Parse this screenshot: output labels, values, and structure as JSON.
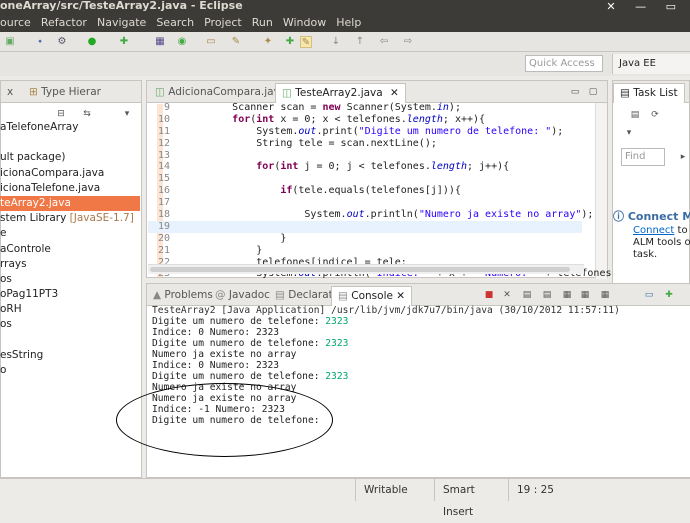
{
  "window": {
    "title": "oneArray/src/TesteArray2.java - Eclipse",
    "controls": "✕ — ▭"
  },
  "menu": [
    "ource",
    "Refactor",
    "Navigate",
    "Search",
    "Project",
    "Run",
    "Window",
    "Help"
  ],
  "quick_access": {
    "placeholder": "Quick Access"
  },
  "perspective": {
    "label": "Java EE"
  },
  "package_explorer": {
    "tabs": [
      {
        "label": "x"
      },
      {
        "label": "Type Hierar"
      }
    ],
    "items": [
      {
        "text": "aTelefoneArray",
        "sel": false,
        "orange": false
      },
      {
        "text": "",
        "sel": false,
        "orange": false
      },
      {
        "text": "ult package)",
        "sel": false,
        "orange": false
      },
      {
        "text": "icionaCompara.java",
        "sel": false,
        "orange": false
      },
      {
        "text": "icionaTelefone.java",
        "sel": false,
        "orange": false
      },
      {
        "text": "teArray2.java",
        "sel": true,
        "orange": false
      },
      {
        "text": "stem Library ",
        "extra": "[JavaSE-1.7]",
        "sel": false,
        "orange": false
      },
      {
        "text": "e",
        "sel": false,
        "orange": false
      },
      {
        "text": "aControle",
        "sel": false,
        "orange": false
      },
      {
        "text": "rrays",
        "sel": false,
        "orange": false
      },
      {
        "text": "os",
        "sel": false,
        "orange": false
      },
      {
        "text": "oPag11PT3",
        "sel": false,
        "orange": false
      },
      {
        "text": "oRH",
        "sel": false,
        "orange": false
      },
      {
        "text": "os",
        "sel": false,
        "orange": false
      },
      {
        "text": "",
        "sel": false,
        "orange": false
      },
      {
        "text": "esString",
        "sel": false,
        "orange": false
      },
      {
        "text": "o",
        "sel": false,
        "orange": false
      }
    ]
  },
  "editor": {
    "tabs": [
      {
        "label": "AdicionaCompara.java"
      },
      {
        "label": "TesteArray2.java"
      }
    ],
    "lines": [
      {
        "n": "9",
        "html": "        Scanner scan = <span class=\"kw\">new</span> Scanner(System.<span class=\"fld\">in</span>);"
      },
      {
        "n": "10",
        "html": "        <span class=\"kw\">for</span>(<span class=\"kw\">int</span> x = 0; x &lt; telefones.<span class=\"fld\">length</span>; x++){"
      },
      {
        "n": "11",
        "html": "            System.<span class=\"fld\">out</span>.print(<span class=\"str\">\"Digite um numero de telefone: \"</span>);"
      },
      {
        "n": "12",
        "html": "            String tele = scan.nextLine();"
      },
      {
        "n": "13",
        "html": ""
      },
      {
        "n": "14",
        "html": "            <span class=\"kw\">for</span>(<span class=\"kw\">int</span> j = 0; j &lt; telefones.<span class=\"fld\">length</span>; j++){"
      },
      {
        "n": "15",
        "html": ""
      },
      {
        "n": "16",
        "html": "                <span class=\"kw\">if</span>(tele.equals(telefones[j])){"
      },
      {
        "n": "17",
        "html": ""
      },
      {
        "n": "18",
        "html": "                    System.<span class=\"fld\">out</span>.println(<span class=\"str\">\"Numero ja existe no array\"</span>);"
      },
      {
        "n": "19",
        "html": ""
      },
      {
        "n": "20",
        "html": "                }"
      },
      {
        "n": "21",
        "html": "            }"
      },
      {
        "n": "22",
        "html": "            telefones[indice] = tele;"
      },
      {
        "n": "23",
        "html": "            System.<span class=\"fld\">out</span>.println(<span class=\"str\">\"Indice: \"</span> + x + <span class=\"str\">\" Numero: \"</span> + telefones[in"
      }
    ]
  },
  "task_list": {
    "tab_label": "Task List",
    "find_placeholder": "Find",
    "connect_title": "Connect M",
    "connect_link": "Connect",
    "connect_text1": " to y",
    "connect_text2": "ALM tools or",
    "connect_text3": "task."
  },
  "bottom_tabs": [
    {
      "label": "Problems"
    },
    {
      "label": "Javadoc"
    },
    {
      "label": "Declaration"
    },
    {
      "label": "Console"
    }
  ],
  "console": {
    "header": "TesteArray2 [Java Application] /usr/lib/jvm/jdk7u7/bin/java (30/10/2012 11:57:11)",
    "lines": [
      {
        "text": "Digite um numero de telefone: ",
        "input": "2323"
      },
      {
        "text": "Indice: 0 Numero: 2323",
        "input": ""
      },
      {
        "text": "Digite um numero de telefone: ",
        "input": "2323"
      },
      {
        "text": "Numero ja existe no array",
        "input": ""
      },
      {
        "text": "Indice: 0 Numero: 2323",
        "input": ""
      },
      {
        "text": "Digite um numero de telefone: ",
        "input": "2323"
      },
      {
        "text": "Numero ja existe no array",
        "input": ""
      },
      {
        "text": "Numero ja existe no array",
        "input": ""
      },
      {
        "text": "Indice: -1 Numero: 2323",
        "input": ""
      },
      {
        "text": "Digite um numero de telefone:",
        "input": ""
      }
    ]
  },
  "status": {
    "writable": "Writable",
    "insert": "Smart Insert",
    "position": "19 : 25"
  },
  "colors": {
    "selection": "#f07746",
    "console_input": "#00a86b",
    "keyword": "#7f0055"
  }
}
